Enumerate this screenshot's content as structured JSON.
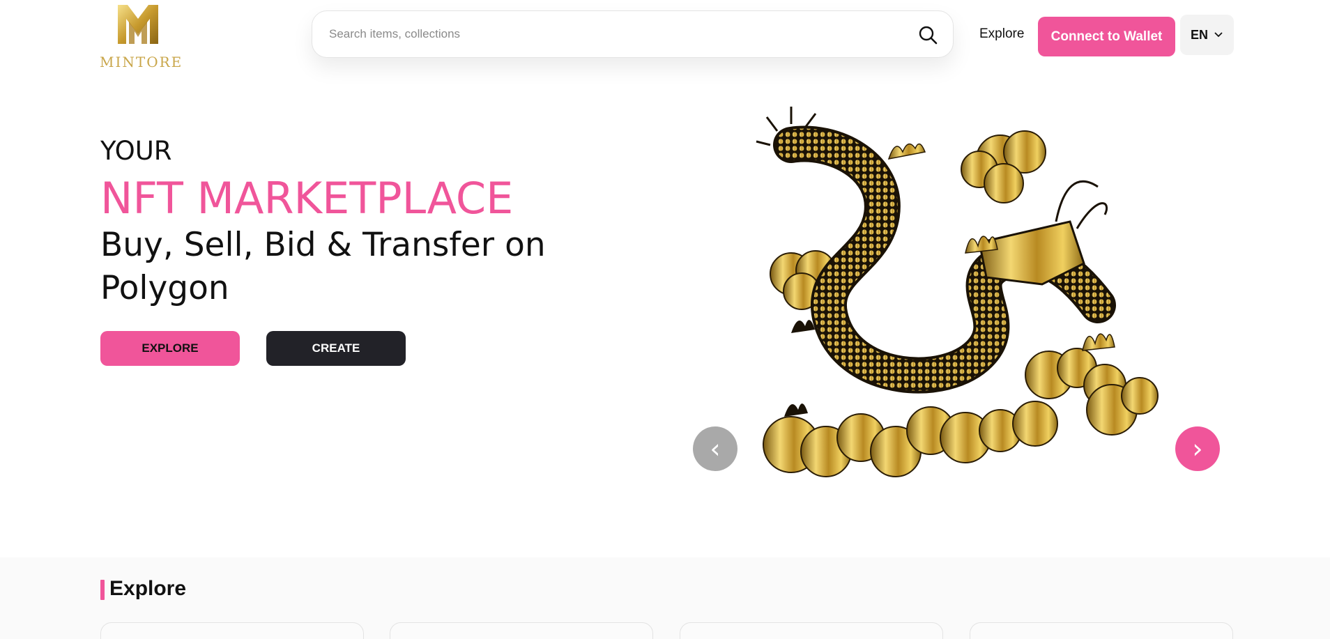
{
  "header": {
    "logo_text": "MINTORE",
    "search_placeholder": "Search items, collections",
    "nav_explore": "Explore",
    "wallet_button": "Connect to Wallet",
    "language": "EN"
  },
  "hero": {
    "kicker": "YOUR",
    "title": "NFT MARKETPLACE",
    "subtitle": "Buy, Sell, Bid & Transfer on Polygon",
    "explore_button": "EXPLORE",
    "create_button": "CREATE",
    "prev_arrow": "‹",
    "next_arrow": "›"
  },
  "explore_section": {
    "title": "Explore",
    "cards": [
      {},
      {},
      {},
      {}
    ]
  },
  "colors": {
    "accent": "#f0559a",
    "dark_button": "#222228",
    "gold": "#c9a64a",
    "arrow_inactive": "#a9a9a9"
  },
  "icons": [
    "logo-mark-icon",
    "search-icon",
    "chevron-down-icon",
    "chevron-left-icon",
    "chevron-right-icon"
  ]
}
